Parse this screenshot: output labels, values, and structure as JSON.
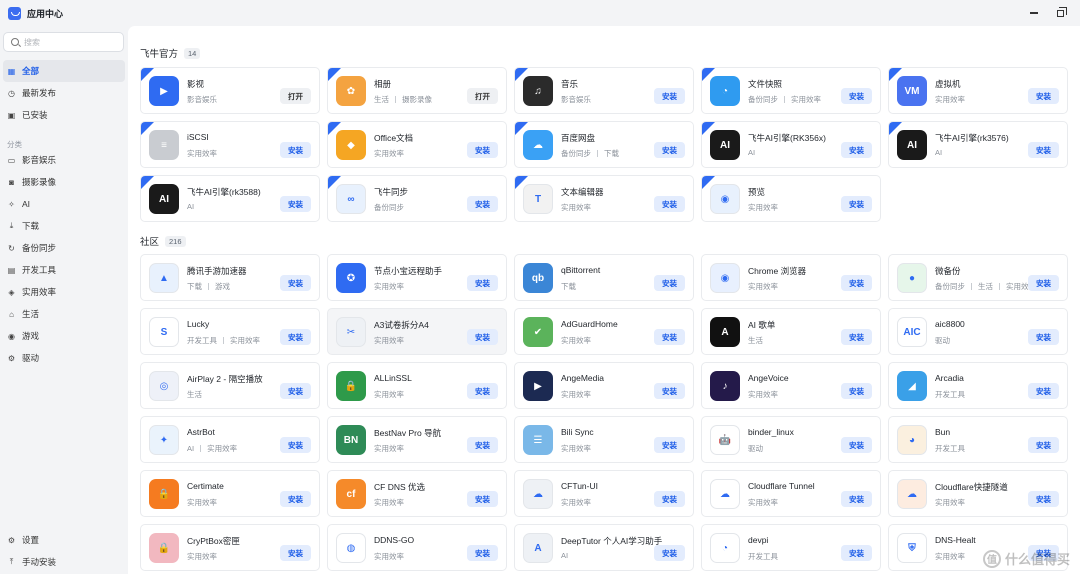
{
  "window": {
    "title": "应用中心"
  },
  "search": {
    "placeholder": "搜索"
  },
  "nav_top": [
    {
      "label": "全部",
      "icon": "grid-icon",
      "glyph": "▦",
      "active": true
    },
    {
      "label": "最新发布",
      "icon": "clock-icon",
      "glyph": "◷"
    },
    {
      "label": "已安装",
      "icon": "installed-icon",
      "glyph": "▣"
    }
  ],
  "nav_section_title": "分类",
  "nav_categories": [
    {
      "label": "影音娱乐",
      "icon": "media-icon",
      "glyph": "▭"
    },
    {
      "label": "摄影录像",
      "icon": "camera-icon",
      "glyph": "◙"
    },
    {
      "label": "AI",
      "icon": "ai-icon",
      "glyph": "✧"
    },
    {
      "label": "下载",
      "icon": "download-icon",
      "glyph": "⤓"
    },
    {
      "label": "备份同步",
      "icon": "sync-icon",
      "glyph": "↻"
    },
    {
      "label": "开发工具",
      "icon": "devtools-icon",
      "glyph": "▤"
    },
    {
      "label": "实用效率",
      "icon": "efficiency-icon",
      "glyph": "◈"
    },
    {
      "label": "生活",
      "icon": "life-icon",
      "glyph": "⌂"
    },
    {
      "label": "游戏",
      "icon": "game-icon",
      "glyph": "◉"
    },
    {
      "label": "驱动",
      "icon": "driver-icon",
      "glyph": "⚙"
    }
  ],
  "nav_bottom": [
    {
      "label": "设置",
      "icon": "settings-icon",
      "glyph": "⚙"
    },
    {
      "label": "手动安装",
      "icon": "upload-icon",
      "glyph": "⤒"
    }
  ],
  "sections": [
    {
      "title": "飞牛官方",
      "count": "14",
      "apps": [
        {
          "name": "影视",
          "tags": [
            "影音娱乐"
          ],
          "button": "打开",
          "state": "open",
          "badge": true,
          "icon": "video-app-icon",
          "color": "#2f6bf2",
          "glyph": "▶"
        },
        {
          "name": "相册",
          "tags": [
            "生活",
            "摄影录像"
          ],
          "button": "打开",
          "state": "open",
          "badge": true,
          "icon": "photos-app-icon",
          "color": "#f4a340",
          "glyph": "✿"
        },
        {
          "name": "音乐",
          "tags": [
            "影音娱乐"
          ],
          "button": "安装",
          "state": "install",
          "badge": true,
          "icon": "music-app-icon",
          "color": "#2b2b2b",
          "glyph": "♫"
        },
        {
          "name": "文件快照",
          "tags": [
            "备份同步",
            "实用效率"
          ],
          "button": "安装",
          "state": "install",
          "badge": true,
          "icon": "snapshot-app-icon",
          "color": "#2f9bf0",
          "glyph": "◔"
        },
        {
          "name": "虚拟机",
          "tags": [
            "实用效率"
          ],
          "button": "安装",
          "state": "install",
          "badge": true,
          "icon": "vm-app-icon",
          "color": "#4a73f0",
          "glyph": "VM"
        },
        {
          "name": "iSCSI",
          "tags": [
            "实用效率"
          ],
          "button": "安装",
          "state": "install",
          "badge": true,
          "icon": "iscsi-app-icon",
          "color": "#c9ccd1",
          "glyph": "≡"
        },
        {
          "name": "Office文档",
          "tags": [
            "实用效率"
          ],
          "button": "安装",
          "state": "install",
          "badge": true,
          "icon": "office-app-icon",
          "color": "#f5a623",
          "glyph": "◆"
        },
        {
          "name": "百度网盘",
          "tags": [
            "备份同步",
            "下载"
          ],
          "button": "安装",
          "state": "install",
          "badge": true,
          "icon": "baidu-netdisk-app-icon",
          "color": "#3aa1f5",
          "glyph": "☁"
        },
        {
          "name": "飞牛AI引擎(RK356x)",
          "tags": [
            "AI"
          ],
          "button": "安装",
          "state": "install",
          "badge": true,
          "icon": "rockchip-app-icon",
          "color": "#1a1a1a",
          "glyph": "AI"
        },
        {
          "name": "飞牛AI引擎(rk3576)",
          "tags": [
            "AI"
          ],
          "button": "安装",
          "state": "install",
          "badge": true,
          "icon": "rockchip-app-icon",
          "color": "#1a1a1a",
          "glyph": "AI"
        },
        {
          "name": "飞牛AI引擎(rk3588)",
          "tags": [
            "AI"
          ],
          "button": "安装",
          "state": "install",
          "badge": true,
          "icon": "rockchip-app-icon",
          "color": "#1a1a1a",
          "glyph": "AI"
        },
        {
          "name": "飞牛同步",
          "tags": [
            "备份同步"
          ],
          "button": "安装",
          "state": "install",
          "badge": true,
          "icon": "fn-sync-app-icon",
          "color": "#e8f1fd",
          "glyph": "∞",
          "dark": true
        },
        {
          "name": "文本编辑器",
          "tags": [
            "实用效率"
          ],
          "button": "安装",
          "state": "install",
          "badge": true,
          "icon": "text-editor-app-icon",
          "color": "#f2f2f2",
          "glyph": "T",
          "dark": true
        },
        {
          "name": "预览",
          "tags": [
            "实用效率"
          ],
          "button": "安装",
          "state": "install",
          "badge": true,
          "icon": "preview-app-icon",
          "color": "#e8f1fd",
          "glyph": "◉",
          "dark": true
        }
      ]
    },
    {
      "title": "社区",
      "count": "216",
      "apps": [
        {
          "name": "腾讯手游加速器",
          "tags": [
            "下载",
            "游戏"
          ],
          "button": "安装",
          "state": "install",
          "icon": "tencent-accelerator-app-icon",
          "color": "#e8f1fd",
          "glyph": "▲",
          "dark": true
        },
        {
          "name": "节点小宝远程助手",
          "tags": [
            "实用效率"
          ],
          "button": "安装",
          "state": "install",
          "icon": "node-remote-app-icon",
          "color": "#2f6bf2",
          "glyph": "✪"
        },
        {
          "name": "qBittorrent",
          "tags": [
            "下载"
          ],
          "button": "安装",
          "state": "install",
          "icon": "qbittorrent-app-icon",
          "color": "#3b86d6",
          "glyph": "qb"
        },
        {
          "name": "Chrome 浏览器",
          "tags": [
            "实用效率"
          ],
          "button": "安装",
          "state": "install",
          "icon": "chrome-app-icon",
          "color": "#e8f0fe",
          "glyph": "◉",
          "dark": true
        },
        {
          "name": "微备份",
          "tags": [
            "备份同步",
            "生活",
            "实用效率"
          ],
          "button": "安装",
          "state": "install",
          "icon": "weibackup-app-icon",
          "color": "#e6f6ea",
          "glyph": "●",
          "dark": true
        },
        {
          "name": "Lucky",
          "tags": [
            "开发工具",
            "实用效率"
          ],
          "button": "安装",
          "state": "install",
          "icon": "lucky-app-icon",
          "color": "#ffffff",
          "glyph": "S",
          "dark": true
        },
        {
          "name": "A3试卷拆分A4",
          "tags": [
            "实用效率"
          ],
          "button": "安装",
          "state": "install",
          "icon": "a3-split-app-icon",
          "color": "#eef1f5",
          "glyph": "✂",
          "dark": true,
          "hl": true
        },
        {
          "name": "AdGuardHome",
          "tags": [
            "实用效率"
          ],
          "button": "安装",
          "state": "install",
          "icon": "adguard-app-icon",
          "color": "#5bb35b",
          "glyph": "✔"
        },
        {
          "name": "AI 歌单",
          "tags": [
            "生活"
          ],
          "button": "安装",
          "state": "install",
          "icon": "ai-playlist-app-icon",
          "color": "#111111",
          "glyph": "A"
        },
        {
          "name": "aic8800",
          "tags": [
            "驱动"
          ],
          "button": "安装",
          "state": "install",
          "icon": "aic-app-icon",
          "color": "#ffffff",
          "glyph": "AIC",
          "dark": true
        },
        {
          "name": "AirPlay 2 - 隔空播放",
          "tags": [
            "生活"
          ],
          "button": "安装",
          "state": "install",
          "icon": "airplay-app-icon",
          "color": "#eef1f8",
          "glyph": "◎",
          "dark": true
        },
        {
          "name": "ALLinSSL",
          "tags": [
            "实用效率"
          ],
          "button": "安装",
          "state": "install",
          "icon": "allinssl-app-icon",
          "color": "#2e9a4a",
          "glyph": "🔒"
        },
        {
          "name": "AngeMedia",
          "tags": [
            "实用效率"
          ],
          "button": "安装",
          "state": "install",
          "icon": "angemedia-app-icon",
          "color": "#1c2a52",
          "glyph": "▶"
        },
        {
          "name": "AngeVoice",
          "tags": [
            "实用效率"
          ],
          "button": "安装",
          "state": "install",
          "icon": "angevoice-app-icon",
          "color": "#241a4a",
          "glyph": "♪"
        },
        {
          "name": "Arcadia",
          "tags": [
            "开发工具"
          ],
          "button": "安装",
          "state": "install",
          "icon": "arcadia-app-icon",
          "color": "#3aa0e8",
          "glyph": "◢"
        },
        {
          "name": "AstrBot",
          "tags": [
            "AI",
            "实用效率"
          ],
          "button": "安装",
          "state": "install",
          "icon": "astrbot-app-icon",
          "color": "#eaf3fc",
          "glyph": "✦",
          "dark": true
        },
        {
          "name": "BestNav Pro 导航",
          "tags": [
            "实用效率"
          ],
          "button": "安装",
          "state": "install",
          "icon": "bestnav-app-icon",
          "color": "#2e8b57",
          "glyph": "BN"
        },
        {
          "name": "Bili Sync",
          "tags": [
            "实用效率"
          ],
          "button": "安装",
          "state": "install",
          "icon": "bilisync-app-icon",
          "color": "#7ab8e8",
          "glyph": "☰"
        },
        {
          "name": "binder_linux",
          "tags": [
            "驱动"
          ],
          "button": "安装",
          "state": "install",
          "icon": "android-app-icon",
          "color": "#ffffff",
          "glyph": "🤖",
          "dark": true
        },
        {
          "name": "Bun",
          "tags": [
            "开发工具"
          ],
          "button": "安装",
          "state": "install",
          "icon": "bun-app-icon",
          "color": "#fbf0df",
          "glyph": "◕",
          "dark": true
        },
        {
          "name": "Certimate",
          "tags": [
            "实用效率"
          ],
          "button": "安装",
          "state": "install",
          "icon": "certimate-app-icon",
          "color": "#f57b20",
          "glyph": "🔒"
        },
        {
          "name": "CF DNS 优选",
          "tags": [
            "实用效率"
          ],
          "button": "安装",
          "state": "install",
          "icon": "cf-dns-app-icon",
          "color": "#f58a2a",
          "glyph": "cf"
        },
        {
          "name": "CFTun-UI",
          "tags": [
            "实用效率"
          ],
          "button": "安装",
          "state": "install",
          "icon": "cftun-app-icon",
          "color": "#eef1f5",
          "glyph": "☁",
          "dark": true
        },
        {
          "name": "Cloudflare Tunnel",
          "tags": [
            "实用效率"
          ],
          "button": "安装",
          "state": "install",
          "icon": "cloudflare-tunnel-app-icon",
          "color": "#ffffff",
          "glyph": "☁",
          "dark": true
        },
        {
          "name": "Cloudflare快捷隧道",
          "tags": [
            "实用效率"
          ],
          "button": "安装",
          "state": "install",
          "icon": "cloudflare-quick-app-icon",
          "color": "#fdece0",
          "glyph": "☁",
          "dark": true
        },
        {
          "name": "CryPtBox密匣",
          "tags": [
            "实用效率"
          ],
          "button": "安装",
          "state": "install",
          "icon": "cryptbox-app-icon",
          "color": "#f2b8c0",
          "glyph": "🔒"
        },
        {
          "name": "DDNS-GO",
          "tags": [
            "实用效率"
          ],
          "button": "安装",
          "state": "install",
          "icon": "ddns-go-app-icon",
          "color": "#ffffff",
          "glyph": "◍",
          "dark": true
        },
        {
          "name": "DeepTutor 个人AI学习助手",
          "tags": [
            "AI"
          ],
          "button": "安装",
          "state": "install",
          "icon": "deeptutor-app-icon",
          "color": "#eef1f5",
          "glyph": "A",
          "dark": true
        },
        {
          "name": "devpi",
          "tags": [
            "开发工具"
          ],
          "button": "安装",
          "state": "install",
          "icon": "devpi-app-icon",
          "color": "#ffffff",
          "glyph": "◔",
          "dark": true
        },
        {
          "name": "DNS-Healt",
          "tags": [
            "实用效率"
          ],
          "button": "安装",
          "state": "install",
          "icon": "dns-health-app-icon",
          "color": "#ffffff",
          "glyph": "⛨",
          "dark": true
        }
      ]
    }
  ],
  "watermark": {
    "text": "什么值得买",
    "logo_text": "值"
  }
}
